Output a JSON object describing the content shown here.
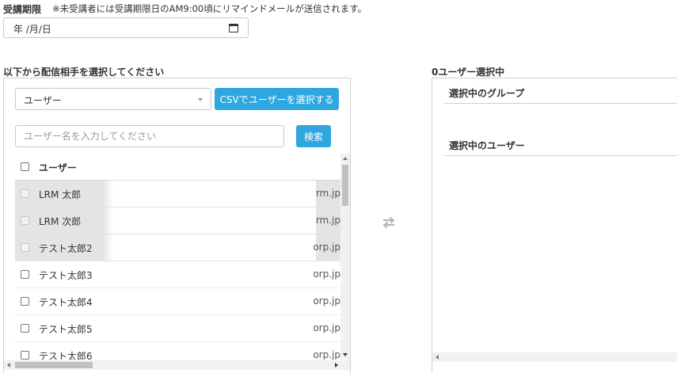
{
  "deadline": {
    "label": "受講期限",
    "note": "※未受講者には受講期限日のAM9:00頃にリマインドメールが送信されます。",
    "date_value": "年 /月/日"
  },
  "select_section": {
    "title": "以下から配信相手を選択してください",
    "type_select_value": "ユーザー",
    "csv_button_label": "CSVでユーザーを選択する",
    "search_placeholder": "ユーザー名を入力してください",
    "search_button_label": "検索",
    "list_header": "ユーザー",
    "users": [
      {
        "name": "LRM 太郎",
        "email": "rm.jp",
        "disabled": true
      },
      {
        "name": "LRM 次郎",
        "email": "rm.jp",
        "disabled": true
      },
      {
        "name": "テスト太郎2",
        "email": "orp.jp",
        "disabled": true
      },
      {
        "name": "テスト太郎3",
        "email": "orp.jp",
        "disabled": false
      },
      {
        "name": "テスト太郎4",
        "email": "orp.jp",
        "disabled": false
      },
      {
        "name": "テスト太郎5",
        "email": "orp.jp",
        "disabled": false
      },
      {
        "name": "テスト太郎6",
        "email": "orp.jp",
        "disabled": false
      }
    ]
  },
  "selected_section": {
    "title": "0ユーザー選択中",
    "groups_header": "選択中のグループ",
    "users_header": "選択中のユーザー"
  },
  "icons": {
    "swap": "swap-arrows-icon",
    "calendar": "calendar-icon",
    "caret": "chevron-down-icon"
  },
  "colors": {
    "primary_button": "#2ea7e0",
    "disabled_row": "#e4e4e4"
  }
}
